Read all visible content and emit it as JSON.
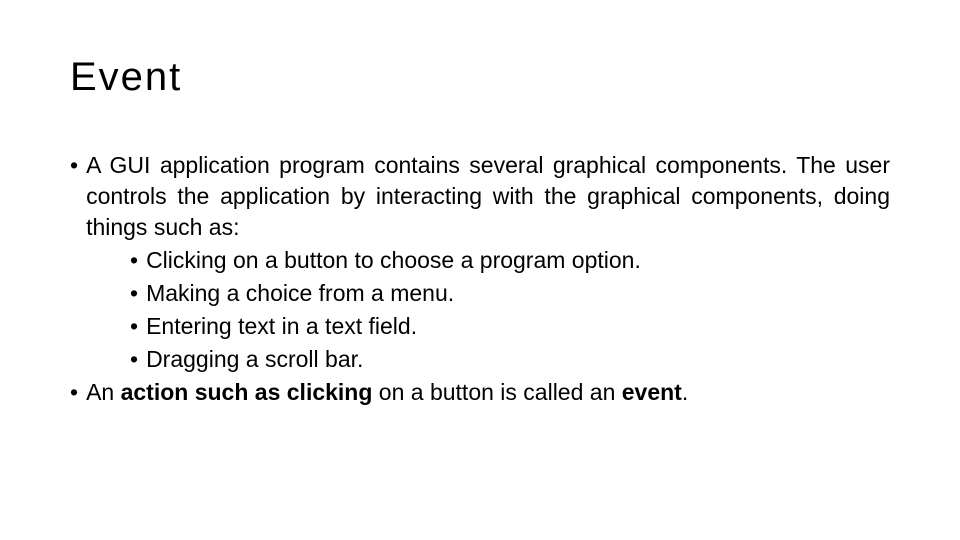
{
  "slide": {
    "title": "Event",
    "para1": "A GUI application program contains several graphical components. The user controls the application by interacting with the graphical components, doing things such as:",
    "sub": [
      "Clicking on a button to choose a program option.",
      "Making a choice from a menu.",
      "Entering text in a text field.",
      "Dragging a scroll bar."
    ],
    "para2_prefix": "An ",
    "para2_bold1": "action such as clicking",
    "para2_mid": " on a button is called an ",
    "para2_bold2": "event",
    "para2_suffix": "."
  }
}
